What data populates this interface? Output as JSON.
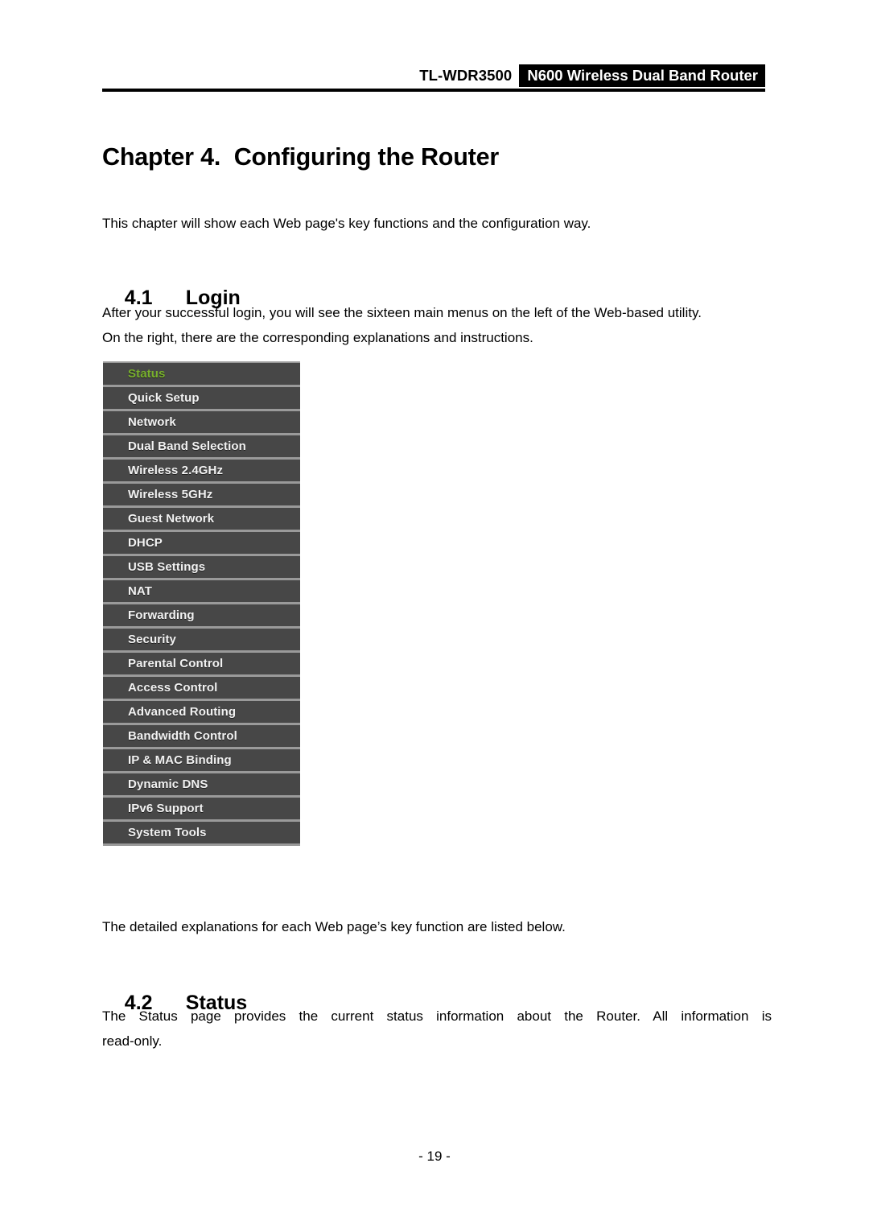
{
  "header": {
    "model": "TL-WDR3500",
    "badge": "N600 Wireless Dual Band Router"
  },
  "chapter": {
    "title": "Chapter 4.  Configuring the Router",
    "intro": "This chapter will show each Web page's key functions and the configuration way."
  },
  "sections": [
    {
      "number": "4.1",
      "title": "Login",
      "body_line1": "After your successful login, you will see the sixteen main menus on the left of the Web-based utility.",
      "body_line2": "On the right, there are the corresponding explanations and instructions.",
      "after_figure": "The detailed explanations for each Web page’s key function are listed below."
    },
    {
      "number": "4.2",
      "title": "Status",
      "body_line1": "The Status page provides the current status information about the Router. All information is",
      "body_line2": "read-only."
    }
  ],
  "router_menu": {
    "active_item": "Status",
    "active_color": "#78b02c",
    "background_color": "#474747",
    "text_color": "#f2f2f2",
    "items": [
      {
        "label": "Status"
      },
      {
        "label": "Quick Setup"
      },
      {
        "label": "Network"
      },
      {
        "label": "Dual Band Selection"
      },
      {
        "label": "Wireless 2.4GHz"
      },
      {
        "label": "Wireless 5GHz"
      },
      {
        "label": "Guest Network"
      },
      {
        "label": "DHCP"
      },
      {
        "label": "USB Settings"
      },
      {
        "label": "NAT"
      },
      {
        "label": "Forwarding"
      },
      {
        "label": "Security"
      },
      {
        "label": "Parental Control"
      },
      {
        "label": "Access Control"
      },
      {
        "label": "Advanced Routing"
      },
      {
        "label": "Bandwidth Control"
      },
      {
        "label": "IP & MAC Binding"
      },
      {
        "label": "Dynamic DNS"
      },
      {
        "label": "IPv6 Support"
      },
      {
        "label": "System Tools"
      }
    ]
  },
  "footer": {
    "page_number": "- 19 -"
  }
}
